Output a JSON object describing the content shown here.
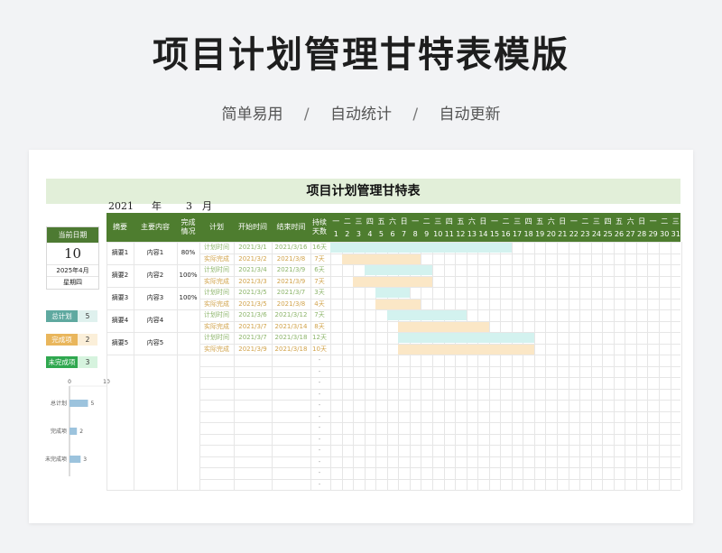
{
  "page": {
    "main_title": "项目计划管理甘特表模版",
    "subtitle_items": [
      "简单易用",
      "自动统计",
      "自动更新"
    ],
    "subtitle_sep": "/"
  },
  "sheet": {
    "title": "项目计划管理甘特表",
    "year": "2021",
    "year_unit": "年",
    "month": "3",
    "month_unit": "月"
  },
  "current_date": {
    "label": "当前日期",
    "day": "10",
    "month_text": "2025年4月",
    "weekday": "星期四"
  },
  "stats": [
    {
      "label": "总计划",
      "value": "5",
      "color": "#5fa9a0",
      "val_bg": "#dff1ee"
    },
    {
      "label": "完成项",
      "value": "2",
      "color": "#e9b65c",
      "val_bg": "#fbefd9"
    },
    {
      "label": "未完成项",
      "value": "3",
      "color": "#2fa84f",
      "val_bg": "#d6f3de"
    }
  ],
  "mini_chart": {
    "type": "bar",
    "categories": [
      "总计划",
      "完成项",
      "未完成项"
    ],
    "values": [
      5,
      2,
      3
    ],
    "xlim": [
      0,
      10
    ],
    "tick_labels": [
      "0",
      "10"
    ],
    "bar_color": "#9cc3dd"
  },
  "table": {
    "headers": {
      "summary": "摘要",
      "content": "主要内容",
      "completion": "完成\n情况",
      "plan": "计划",
      "start": "开始时间",
      "end": "结束时间",
      "duration": "持续\n天数"
    },
    "weekdays": [
      "一",
      "二",
      "三",
      "四",
      "五",
      "六",
      "日",
      "一",
      "二",
      "三",
      "四",
      "五",
      "六",
      "日",
      "一",
      "二",
      "三",
      "四",
      "五",
      "六",
      "日",
      "一",
      "二",
      "三",
      "四",
      "五",
      "六",
      "日",
      "一",
      "二",
      "三"
    ],
    "days": [
      "1",
      "2",
      "3",
      "4",
      "5",
      "6",
      "7",
      "8",
      "9",
      "10",
      "11",
      "12",
      "13",
      "14",
      "15",
      "16",
      "17",
      "18",
      "19",
      "20",
      "21",
      "22",
      "23",
      "24",
      "25",
      "26",
      "27",
      "28",
      "29",
      "30",
      "31"
    ],
    "plan_label": "计划时间",
    "actual_label": "实际完成",
    "tasks": [
      {
        "summary": "摘要1",
        "content": "内容1",
        "completion": "80%",
        "plan_start": "2021/3/1",
        "plan_end": "2021/3/16",
        "plan_days": "16天",
        "actual_start": "2021/3/2",
        "actual_end": "2021/3/8",
        "actual_days": "7天",
        "plan_range": [
          1,
          16
        ],
        "actual_range": [
          2,
          8
        ]
      },
      {
        "summary": "摘要2",
        "content": "内容2",
        "completion": "100%",
        "plan_start": "2021/3/4",
        "plan_end": "2021/3/9",
        "plan_days": "6天",
        "actual_start": "2021/3/3",
        "actual_end": "2021/3/9",
        "actual_days": "7天",
        "plan_range": [
          4,
          9
        ],
        "actual_range": [
          3,
          9
        ]
      },
      {
        "summary": "摘要3",
        "content": "内容3",
        "completion": "100%",
        "plan_start": "2021/3/5",
        "plan_end": "2021/3/7",
        "plan_days": "3天",
        "actual_start": "2021/3/5",
        "actual_end": "2021/3/8",
        "actual_days": "4天",
        "plan_range": [
          5,
          7
        ],
        "actual_range": [
          5,
          8
        ]
      },
      {
        "summary": "摘要4",
        "content": "内容4",
        "completion": "",
        "plan_start": "2021/3/6",
        "plan_end": "2021/3/12",
        "plan_days": "7天",
        "actual_start": "2021/3/7",
        "actual_end": "2021/3/14",
        "actual_days": "8天",
        "plan_range": [
          6,
          12
        ],
        "actual_range": [
          7,
          14
        ]
      },
      {
        "summary": "摘要5",
        "content": "内容5",
        "completion": "",
        "plan_start": "2021/3/7",
        "plan_end": "2021/3/18",
        "plan_days": "12天",
        "actual_start": "2021/3/9",
        "actual_end": "2021/3/18",
        "actual_days": "10天",
        "plan_range": [
          7,
          18
        ],
        "actual_range": [
          7,
          18
        ]
      }
    ],
    "empty_marker": "-"
  },
  "colors": {
    "header_green": "#4e7d2f",
    "title_band": "#e2efd9",
    "plan_bar": "#d3f2ef",
    "actual_bar": "#fbe7c6"
  }
}
